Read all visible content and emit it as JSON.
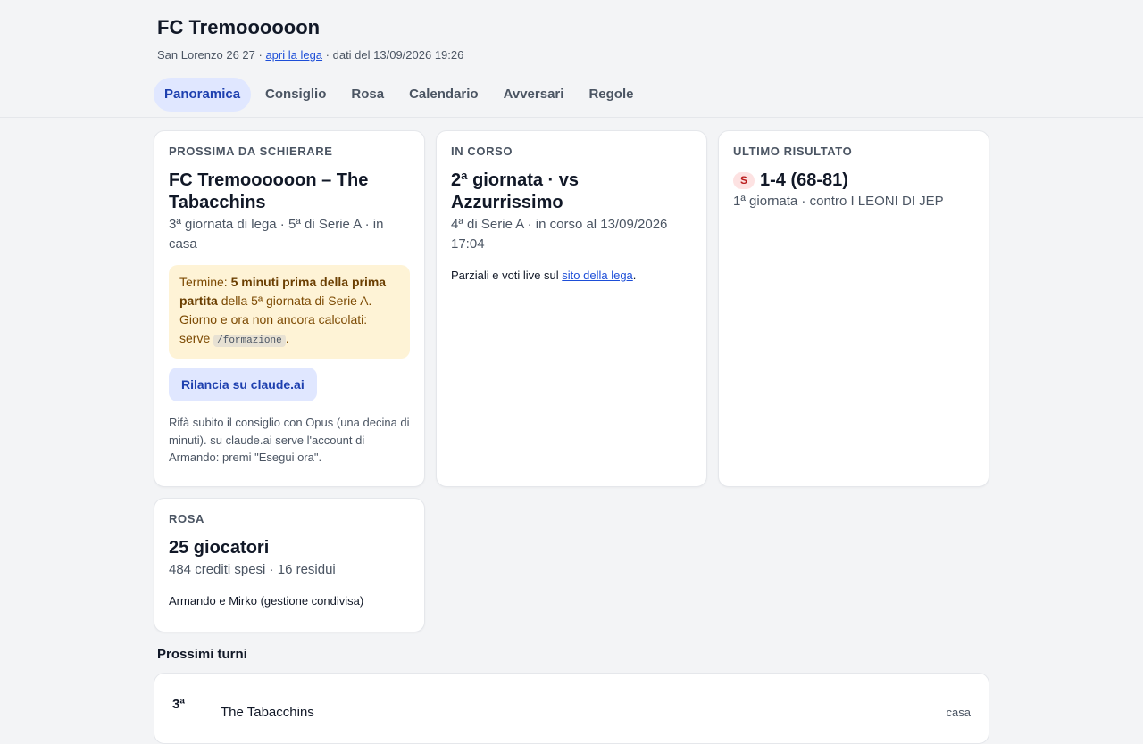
{
  "header": {
    "title": "FC Tremoooooon",
    "meta_prefix": "San Lorenzo 26 27 ·",
    "league_link": "apri la lega",
    "meta_suffix": "· dati del 13/09/2026 19:26"
  },
  "tabs": [
    {
      "label": "Panoramica",
      "active": true
    },
    {
      "label": "Consiglio"
    },
    {
      "label": "Rosa"
    },
    {
      "label": "Calendario"
    },
    {
      "label": "Avversari"
    },
    {
      "label": "Regole"
    }
  ],
  "next_match": {
    "label": "PROSSIMA DA SCHIERARE",
    "title": "FC Tremoooooon – The Tabacchins",
    "subtitle": "3ª giornata di lega · 5ª di Serie A · in casa",
    "deadline_prefix": "Termine:",
    "deadline_bold": "5 minuti prima della prima partita",
    "deadline_rest": "della 5ª giornata di Serie A. Giorno e ora non ancora calcolati: serve",
    "deadline_code": "/formazione",
    "deadline_end": ".",
    "relaunch_label": "Rilancia su claude.ai",
    "note": "Rifà subito il consiglio con Opus (una decina di minuti). su claude.ai serve l'account di Armando: premi \"Esegui ora\"."
  },
  "in_progress": {
    "label": "IN CORSO",
    "title": "2ª giornata · vs Azzurrissimo",
    "subtitle": "4ª di Serie A · in corso al 13/09/2026 17:04",
    "text_prefix": "Parziali e voti live sul",
    "link": "sito della lega",
    "text_suffix": "."
  },
  "last_result": {
    "label": "ULTIMO RISULTATO",
    "badge": "S",
    "badge_color": "#b91c1c",
    "score": "1-4 (68-81)",
    "subtitle": "1ª giornata · contro I LEONI DI JEP"
  },
  "roster": {
    "label": "ROSA",
    "title": "25 giocatori",
    "subtitle": "484 crediti spesi · 16 residui",
    "managers": "Armando e Mirko (gestione condivisa)"
  },
  "upcoming": {
    "title": "Prossimi turni",
    "rows": [
      {
        "round": "3ª",
        "opponent": "The Tabacchins",
        "where": "casa"
      }
    ]
  }
}
